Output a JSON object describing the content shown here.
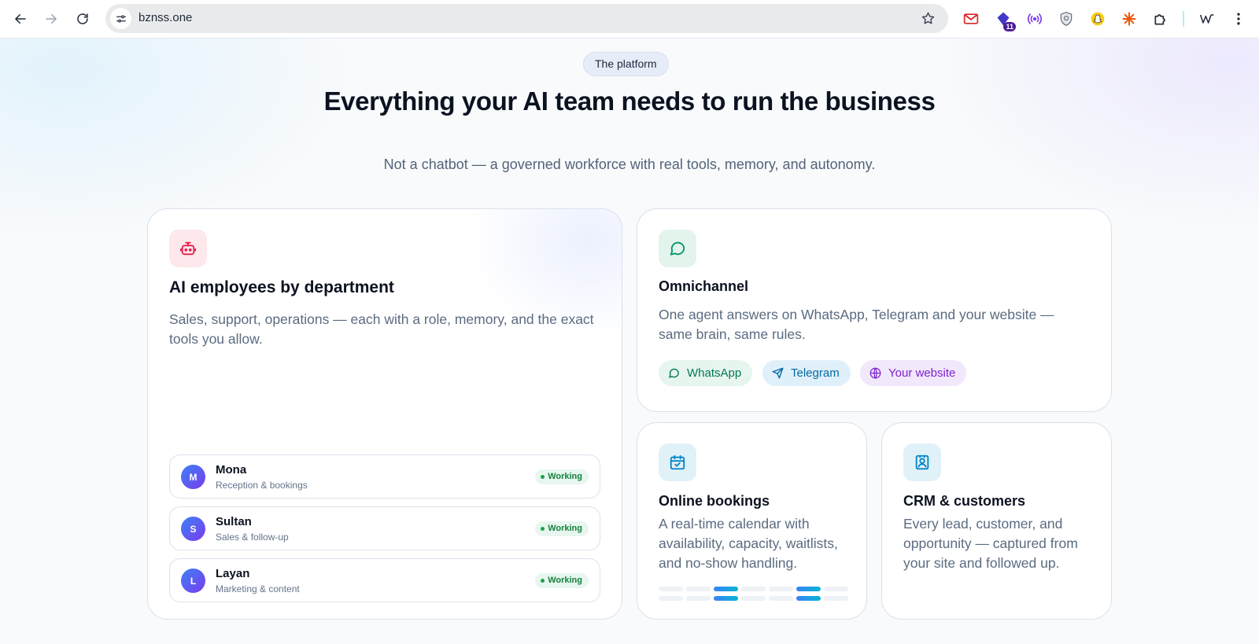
{
  "browser": {
    "url": "bznss.one",
    "extensions": [
      {
        "name": "gmail-extension-icon"
      },
      {
        "name": "purple-extension-icon",
        "badge": "11"
      },
      {
        "name": "broadcast-extension-icon"
      },
      {
        "name": "shield-extension-icon"
      },
      {
        "name": "snapchat-extension-icon"
      },
      {
        "name": "asterisk-extension-icon"
      },
      {
        "name": "puzzle-extensions-icon"
      },
      {
        "name": "w-extension-icon"
      }
    ]
  },
  "hero": {
    "eyebrow": "The platform",
    "title": "Everything your AI team needs to run the business",
    "subtitle": "Not a chatbot — a governed workforce with real tools, memory, and autonomy."
  },
  "cards": {
    "employees": {
      "title": "AI employees by department",
      "text": "Sales, support, operations — each with a role, memory, and the exact tools you allow.",
      "icon": "robot-icon",
      "rows": [
        {
          "initial": "M",
          "name": "Mona",
          "role": "Reception & bookings",
          "status": "Working"
        },
        {
          "initial": "S",
          "name": "Sultan",
          "role": "Sales & follow-up",
          "status": "Working"
        },
        {
          "initial": "L",
          "name": "Layan",
          "role": "Marketing & content",
          "status": "Working"
        }
      ]
    },
    "omnichannel": {
      "title": "Omnichannel",
      "text": "One agent answers on WhatsApp, Telegram and your website — same brain, same rules.",
      "icon": "chat-bubble-icon",
      "channels": [
        {
          "label": "WhatsApp",
          "icon": "whatsapp-icon",
          "color": "#047857",
          "bg": "#e6f5ee"
        },
        {
          "label": "Telegram",
          "icon": "send-icon",
          "color": "#0369a1",
          "bg": "#e0f0fa"
        },
        {
          "label": "Your website",
          "icon": "globe-icon",
          "color": "#7e22ce",
          "bg": "#f1e8fb"
        }
      ]
    },
    "bookings": {
      "title": "Online bookings",
      "text": "A real-time calendar with availability, capacity, waitlists, and no-show handling.",
      "icon": "calendar-check-icon"
    },
    "crm": {
      "title": "CRM & customers",
      "text": "Every lead, customer, and opportunity — captured from your site and followed up.",
      "icon": "contact-card-icon"
    }
  },
  "colors": {
    "accent_red": "#e11d48",
    "accent_green": "#059669",
    "accent_blue": "#0284c7",
    "status_green": "#15803d"
  }
}
